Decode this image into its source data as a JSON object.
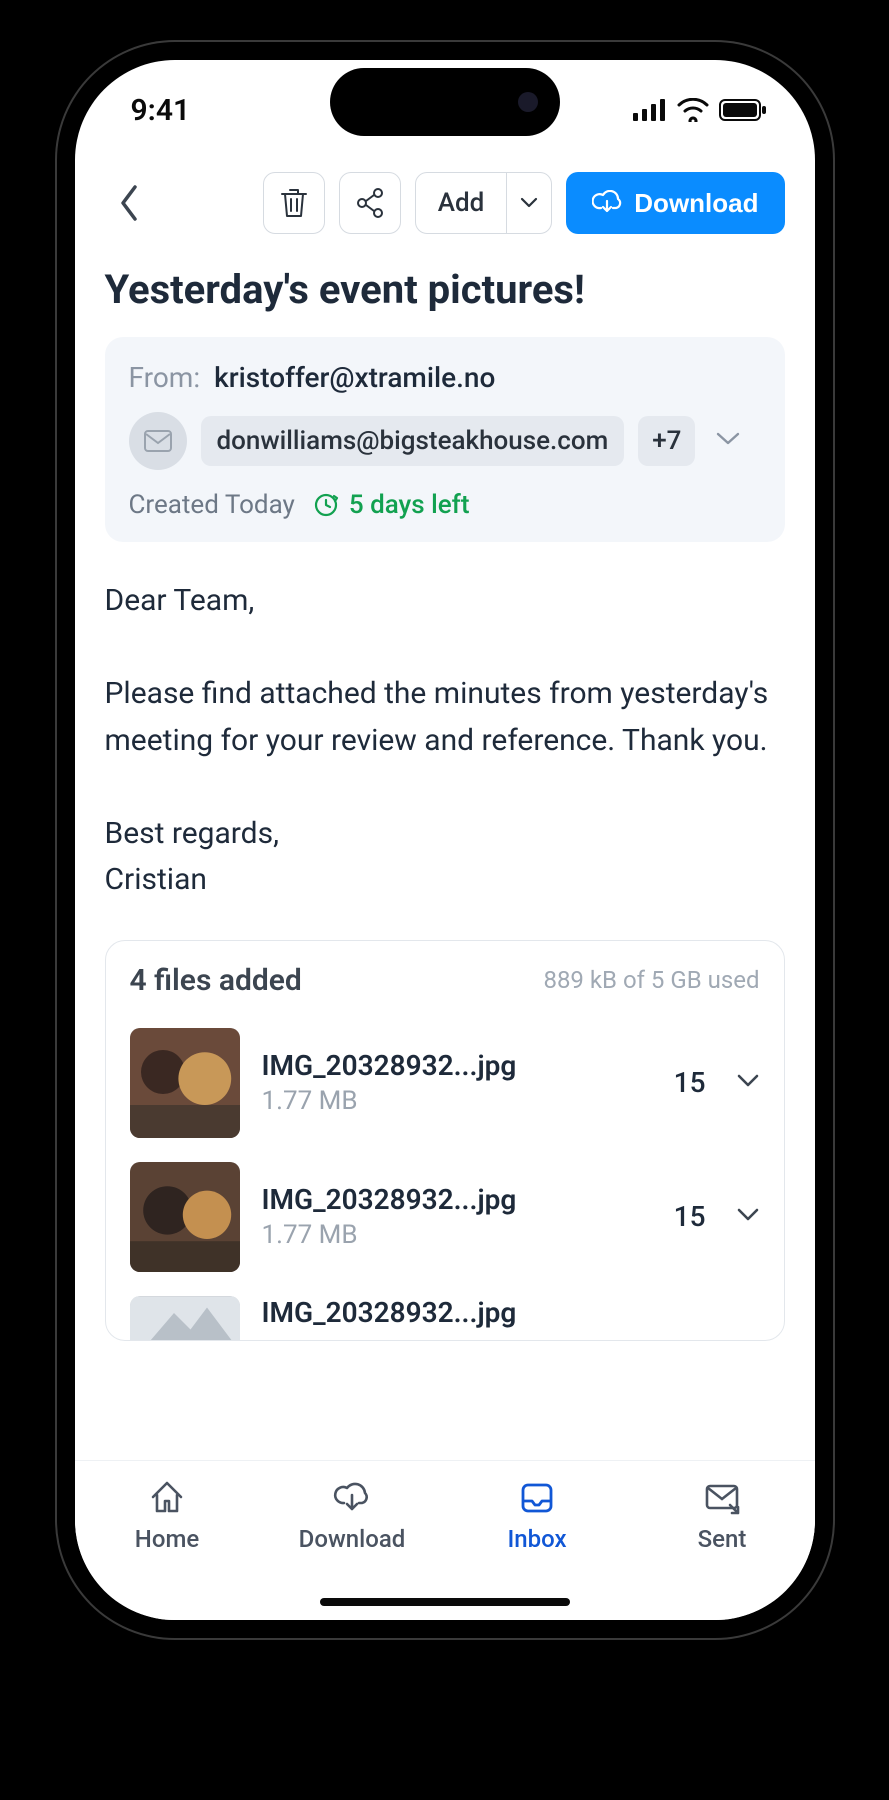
{
  "status": {
    "time": "9:41"
  },
  "toolbar": {
    "add_label": "Add",
    "download_label": "Download"
  },
  "title": "Yesterday's event pictures!",
  "meta": {
    "from_label": "From:",
    "from_email": "kristoffer@xtramile.no",
    "to_email": "donwilliams@bigsteakhouse.com",
    "extra_recipients": "+7",
    "created_label": "Created Today",
    "days_left": "5 days left"
  },
  "body": "Dear Team,\n\nPlease find attached the minutes from yesterday's meeting for your review and reference. Thank you.\n\nBest regards,\nCristian",
  "files": {
    "title": "4 files added",
    "usage": "889 kB of 5 GB used",
    "items": [
      {
        "name": "IMG_20328932...jpg",
        "size": "1.77 MB",
        "count": "15"
      },
      {
        "name": "IMG_20328932...jpg",
        "size": "1.77 MB",
        "count": "15"
      },
      {
        "name": "IMG_20328932...jpg",
        "size": "",
        "count": ""
      }
    ]
  },
  "tabs": {
    "home": "Home",
    "download": "Download",
    "inbox": "Inbox",
    "sent": "Sent"
  }
}
